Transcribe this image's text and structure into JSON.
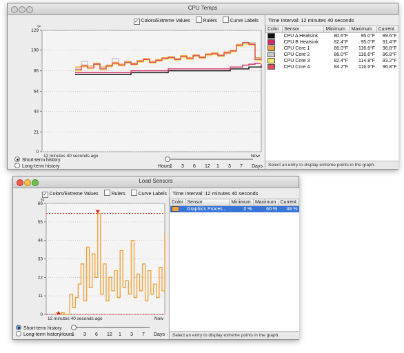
{
  "cpu_window": {
    "title": "CPU Temps",
    "options": {
      "colors_extreme": "Colors/Extreme Values",
      "colors_checked": "✓",
      "rulers": "Rulers",
      "curve_labels": "Curve Labels"
    },
    "unit": "°F",
    "y_ticks": [
      "129",
      "108",
      "86",
      "64",
      "43",
      "21",
      "0"
    ],
    "x_start": "12 minutes 40 seconds ago",
    "x_end": "Now",
    "radio_short": "Short-term history",
    "radio_long": "Long-term history",
    "slider_labels": [
      "Hours",
      "1",
      "3",
      "6",
      "12",
      "1",
      "3",
      "7",
      "Days"
    ],
    "time_interval": "Time Interval: 12 minutes 40 seconds",
    "columns": [
      "Color",
      "Sensor",
      "Minimum",
      "Maximum",
      "Current"
    ],
    "rows": [
      {
        "color": "#111111",
        "name": "CPU A Heatsink",
        "min": "80.6°F",
        "max": "95.0°F",
        "cur": "89.6°F"
      },
      {
        "color": "#d0306a",
        "name": "CPU B Heatsink",
        "min": "82.4°F",
        "max": "95.0°F",
        "cur": "91.4°F"
      },
      {
        "color": "#f0a23c",
        "name": "CPU Core 1",
        "min": "86.0°F",
        "max": "116.6°F",
        "cur": "96.8°F"
      },
      {
        "color": "#c8c8c8",
        "name": "CPU Core 2",
        "min": "86.0°F",
        "max": "116.6°F",
        "cur": "96.8°F"
      },
      {
        "color": "#f3e76a",
        "name": "CPU Core 3",
        "min": "82.4°F",
        "max": "114.8°F",
        "cur": "93.2°F"
      },
      {
        "color": "#e0505a",
        "name": "CPU Core 4",
        "min": "84.2°F",
        "max": "116.6°F",
        "cur": "96.8°F"
      }
    ],
    "footer": "Select an entry to display extreme points in the graph."
  },
  "load_window": {
    "title": "Load Sensors",
    "options": {
      "colors_extreme": "Colors/Extreme Values",
      "colors_checked": "✓",
      "rulers": "Rulers",
      "curve_labels": "Curve Labels"
    },
    "unit": "%",
    "y_ticks": [
      "66",
      "55",
      "44",
      "33",
      "22",
      "11",
      "0"
    ],
    "x_start": "12 minutes 40 seconds ago",
    "x_end": "Now",
    "radio_short": "Short-term history",
    "radio_long": "Long-term history",
    "slider_labels": [
      "Hours",
      "1",
      "3",
      "6",
      "12",
      "1",
      "3",
      "7",
      "Days"
    ],
    "time_interval": "Time Interval: 12 minutes 40 seconds",
    "columns": [
      "Color",
      "Sensor",
      "Minimum",
      "Maximum",
      "Current"
    ],
    "rows": [
      {
        "color": "#f0a23c",
        "name": "Graphics Proces...",
        "min": "0 %",
        "max": "60 %",
        "cur": "48 %"
      }
    ],
    "footer": "Select an entry to display extreme points in the graph."
  },
  "chart_data": [
    {
      "type": "line",
      "title": "CPU Temps",
      "ylabel": "°F",
      "ylim": [
        0,
        129
      ],
      "y_ticks": [
        0,
        21,
        43,
        64,
        86,
        108,
        129
      ],
      "series": [
        {
          "name": "CPU A Heatsink",
          "color": "#111111",
          "values": [
            82,
            82,
            82,
            82,
            82,
            82,
            82,
            82,
            82,
            84,
            84,
            84,
            84,
            84,
            84,
            86,
            86,
            86,
            86,
            86,
            86,
            86,
            86,
            86,
            86,
            88,
            88,
            88,
            90,
            90,
            91
          ]
        },
        {
          "name": "CPU B Heatsink",
          "color": "#d0306a",
          "values": [
            84,
            84,
            84,
            84,
            84,
            84,
            84,
            84,
            84,
            86,
            86,
            86,
            86,
            86,
            86,
            88,
            88,
            88,
            88,
            88,
            88,
            88,
            88,
            88,
            88,
            90,
            90,
            92,
            93,
            94,
            91
          ]
        },
        {
          "name": "CPU Core 1",
          "color": "#f0a23c",
          "values": [
            90,
            92,
            91,
            94,
            90,
            92,
            95,
            93,
            96,
            94,
            97,
            99,
            96,
            98,
            100,
            101,
            99,
            102,
            100,
            103,
            101,
            104,
            105,
            103,
            106,
            108,
            114,
            116,
            115,
            100,
            97
          ]
        },
        {
          "name": "CPU Core 2",
          "color": "#c8c8c8",
          "values": [
            88,
            96,
            89,
            93,
            88,
            91,
            99,
            92,
            95,
            93,
            96,
            98,
            95,
            97,
            99,
            100,
            98,
            101,
            99,
            102,
            100,
            103,
            104,
            102,
            105,
            107,
            113,
            115,
            116,
            99,
            97
          ]
        },
        {
          "name": "CPU Core 3",
          "color": "#f3e76a",
          "values": [
            86,
            90,
            88,
            92,
            87,
            90,
            93,
            91,
            94,
            92,
            95,
            97,
            94,
            96,
            98,
            99,
            97,
            100,
            98,
            101,
            99,
            102,
            103,
            101,
            104,
            106,
            112,
            114,
            113,
            97,
            93
          ]
        },
        {
          "name": "CPU Core 4",
          "color": "#e0505a",
          "values": [
            87,
            91,
            89,
            93,
            88,
            91,
            94,
            92,
            95,
            93,
            96,
            98,
            95,
            97,
            99,
            100,
            98,
            101,
            99,
            102,
            100,
            103,
            104,
            102,
            105,
            107,
            113,
            116,
            114,
            98,
            97
          ]
        }
      ]
    },
    {
      "type": "line",
      "title": "Load Sensors",
      "ylabel": "%",
      "ylim": [
        0,
        66
      ],
      "y_ticks": [
        0,
        11,
        22,
        33,
        44,
        55,
        66
      ],
      "extreme_max": 60,
      "series": [
        {
          "name": "Graphics Proces...",
          "color": "#f0a23c",
          "values": [
            1,
            0,
            1,
            0,
            0,
            12,
            4,
            10,
            18,
            30,
            8,
            40,
            16,
            36,
            22,
            60,
            12,
            30,
            8,
            22,
            14,
            26,
            10,
            38,
            16,
            20,
            12,
            44,
            10,
            24,
            14,
            30,
            8,
            26,
            12,
            18,
            10,
            28,
            14,
            48
          ]
        }
      ]
    }
  ]
}
